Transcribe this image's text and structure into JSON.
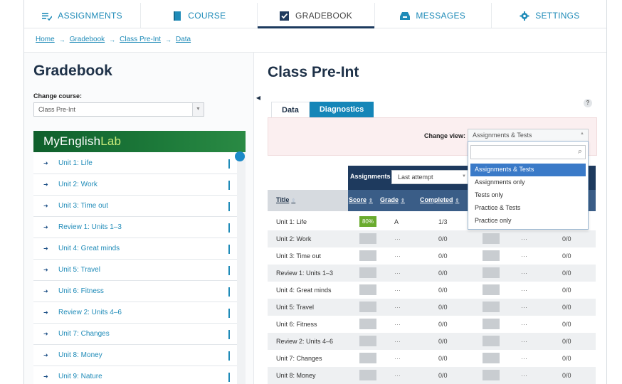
{
  "nav": {
    "items": [
      {
        "label": "ASSIGNMENTS",
        "icon": "list-check-icon"
      },
      {
        "label": "COURSE",
        "icon": "book-icon"
      },
      {
        "label": "GRADEBOOK",
        "icon": "checkbox-icon"
      },
      {
        "label": "MESSAGES",
        "icon": "inbox-icon"
      },
      {
        "label": "SETTINGS",
        "icon": "gear-icon"
      }
    ],
    "active": "GRADEBOOK"
  },
  "breadcrumb": {
    "items": [
      "Home",
      "Gradebook",
      "Class Pre-Int",
      "Data"
    ],
    "separator": "→"
  },
  "left": {
    "title": "Gradebook",
    "change_course_label": "Change course:",
    "course_value": "Class Pre-Int",
    "banner": {
      "part1": "MyEnglish",
      "part2": "Lab"
    },
    "units": [
      "Unit 1: Life",
      "Unit 2: Work",
      "Unit 3: Time out",
      "Review 1: Units 1–3",
      "Unit 4: Great minds",
      "Unit 5: Travel",
      "Unit 6: Fitness",
      "Review 2: Units 4–6",
      "Unit 7: Changes",
      "Unit 8: Money",
      "Unit 9: Nature"
    ]
  },
  "main": {
    "title": "Class Pre-Int",
    "help": "?",
    "tabs": [
      {
        "label": "Data"
      },
      {
        "label": "Diagnostics"
      }
    ],
    "change_view_label": "Change view:",
    "view_value": "Assignments & Tests",
    "view_options": [
      "Assignments & Tests",
      "Assignments only",
      "Tests only",
      "Practice & Tests",
      "Practice only"
    ],
    "view_selected_index": 0,
    "assignments_label": "Assignments",
    "attempt_value": "Last attempt",
    "columns": {
      "title": "Title",
      "score": "Score",
      "grade": "Grade",
      "completed": "Completed"
    },
    "rows": [
      {
        "title": "Unit 1: Life",
        "score": "80%",
        "grade": "A",
        "completed": "1/3",
        "grade2": "",
        "completed2": ""
      },
      {
        "title": "Unit 2: Work",
        "score": "",
        "grade": "···",
        "completed": "0/0",
        "grade2": "···",
        "completed2": "0/0"
      },
      {
        "title": "Unit 3: Time out",
        "score": "",
        "grade": "···",
        "completed": "0/0",
        "grade2": "···",
        "completed2": "0/0"
      },
      {
        "title": "Review 1: Units 1–3",
        "score": "",
        "grade": "···",
        "completed": "0/0",
        "grade2": "···",
        "completed2": "0/0"
      },
      {
        "title": "Unit 4: Great minds",
        "score": "",
        "grade": "···",
        "completed": "0/0",
        "grade2": "···",
        "completed2": "0/0"
      },
      {
        "title": "Unit 5: Travel",
        "score": "",
        "grade": "···",
        "completed": "0/0",
        "grade2": "···",
        "completed2": "0/0"
      },
      {
        "title": "Unit 6: Fitness",
        "score": "",
        "grade": "···",
        "completed": "0/0",
        "grade2": "···",
        "completed2": "0/0"
      },
      {
        "title": "Review 2: Units 4–6",
        "score": "",
        "grade": "···",
        "completed": "0/0",
        "grade2": "···",
        "completed2": "0/0"
      },
      {
        "title": "Unit 7: Changes",
        "score": "",
        "grade": "···",
        "completed": "0/0",
        "grade2": "···",
        "completed2": "0/0"
      },
      {
        "title": "Unit 8: Money",
        "score": "",
        "grade": "···",
        "completed": "0/0",
        "grade2": "···",
        "completed2": "0/0"
      }
    ]
  },
  "colors": {
    "navy": "#1e3a5e",
    "accent_blue": "#1f8bb8",
    "tab_blue": "#1586b8",
    "score_green": "#6aab2e",
    "banner_green": "#1d7a3a"
  }
}
